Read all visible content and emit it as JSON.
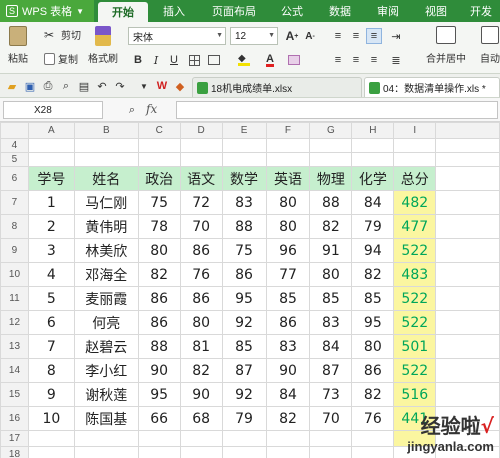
{
  "app": {
    "name": "WPS 表格"
  },
  "tabs": [
    {
      "label": "开始",
      "active": true
    },
    {
      "label": "插入"
    },
    {
      "label": "页面布局"
    },
    {
      "label": "公式"
    },
    {
      "label": "数据"
    },
    {
      "label": "审阅"
    },
    {
      "label": "视图"
    },
    {
      "label": "开发"
    }
  ],
  "ribbon": {
    "paste": "粘贴",
    "cut": "剪切",
    "copy": "复制",
    "format_painter": "格式刷",
    "font_name": "宋体",
    "font_size": "12",
    "bold": "B",
    "italic": "I",
    "underline": "U",
    "font_grow": "A",
    "font_shrink": "A",
    "merge_center": "合并居中",
    "auto_wrap": "自动"
  },
  "doc_tabs": [
    {
      "label": "18机电成绩单.xlsx"
    },
    {
      "label": "04：数据清单操作.xls *",
      "active": true
    }
  ],
  "formula_bar": {
    "name_box": "X28",
    "fx": "fx",
    "value": ""
  },
  "columns": [
    "A",
    "B",
    "C",
    "D",
    "E",
    "F",
    "G",
    "H",
    "I"
  ],
  "headers": [
    "学号",
    "姓名",
    "政治",
    "语文",
    "数学",
    "英语",
    "物理",
    "化学",
    "总分"
  ],
  "rows": [
    [
      "1",
      "马仁刚",
      "75",
      "72",
      "83",
      "80",
      "88",
      "84",
      "482"
    ],
    [
      "2",
      "黄伟明",
      "78",
      "70",
      "88",
      "80",
      "82",
      "79",
      "477"
    ],
    [
      "3",
      "林美欣",
      "80",
      "86",
      "75",
      "96",
      "91",
      "94",
      "522"
    ],
    [
      "4",
      "邓海全",
      "82",
      "76",
      "86",
      "77",
      "80",
      "82",
      "483"
    ],
    [
      "5",
      "麦丽霞",
      "86",
      "86",
      "95",
      "85",
      "85",
      "85",
      "522"
    ],
    [
      "6",
      "何亮",
      "86",
      "80",
      "92",
      "86",
      "83",
      "95",
      "522"
    ],
    [
      "7",
      "赵碧云",
      "88",
      "81",
      "85",
      "83",
      "84",
      "80",
      "501"
    ],
    [
      "8",
      "李小红",
      "90",
      "82",
      "87",
      "90",
      "87",
      "86",
      "522"
    ],
    [
      "9",
      "谢秋莲",
      "95",
      "90",
      "92",
      "84",
      "73",
      "82",
      "516"
    ],
    [
      "10",
      "陈国基",
      "66",
      "68",
      "79",
      "82",
      "70",
      "76",
      "441"
    ]
  ],
  "row_numbers": {
    "top": [
      "4",
      "5"
    ],
    "header": "6",
    "data": [
      "7",
      "8",
      "9",
      "10",
      "11",
      "12",
      "13",
      "14",
      "15",
      "16"
    ],
    "bottom": [
      "17",
      "18"
    ]
  },
  "watermark": {
    "line1": "经验啦",
    "check": "√",
    "line2": "jingyanla.com"
  },
  "colors": {
    "ribbon_green": "#2f8c3a",
    "header_fill": "#c6efce",
    "total_fill": "#fbf6a0",
    "total_text": "#00a65a"
  }
}
